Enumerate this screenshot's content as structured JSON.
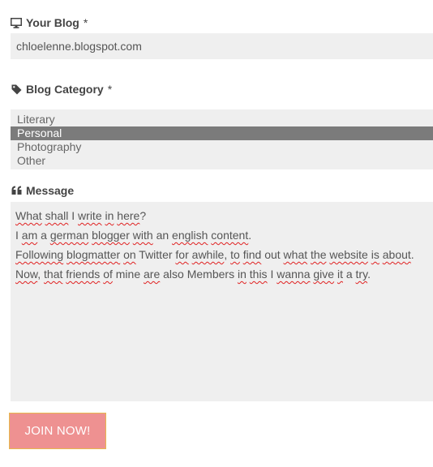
{
  "blog": {
    "label": "Your Blog",
    "required_mark": "*",
    "icon": "monitor-icon",
    "value": "chloelenne.blogspot.com"
  },
  "category": {
    "label": "Blog Category",
    "required_mark": "*",
    "icon": "tag-icon",
    "options": [
      "Literary",
      "Personal",
      "Photography",
      "Other"
    ],
    "selected": "Personal"
  },
  "message": {
    "label": "Message",
    "icon": "quote-icon",
    "lines": [
      "What shall I write in here?",
      "I am a german blogger with an english content.",
      "Following blogmatter on Twitter for awhile, to find out what the website is about.",
      "Now, that friends of mine are also Members in this I wanna give it a try."
    ]
  },
  "join_button": {
    "label": "JOIN NOW!",
    "background": "#ee9191",
    "border": "#e8b84e"
  },
  "colors": {
    "field_background": "#efefef",
    "selected_option": "#7b7b7b",
    "spellcheck": "#e02020"
  }
}
